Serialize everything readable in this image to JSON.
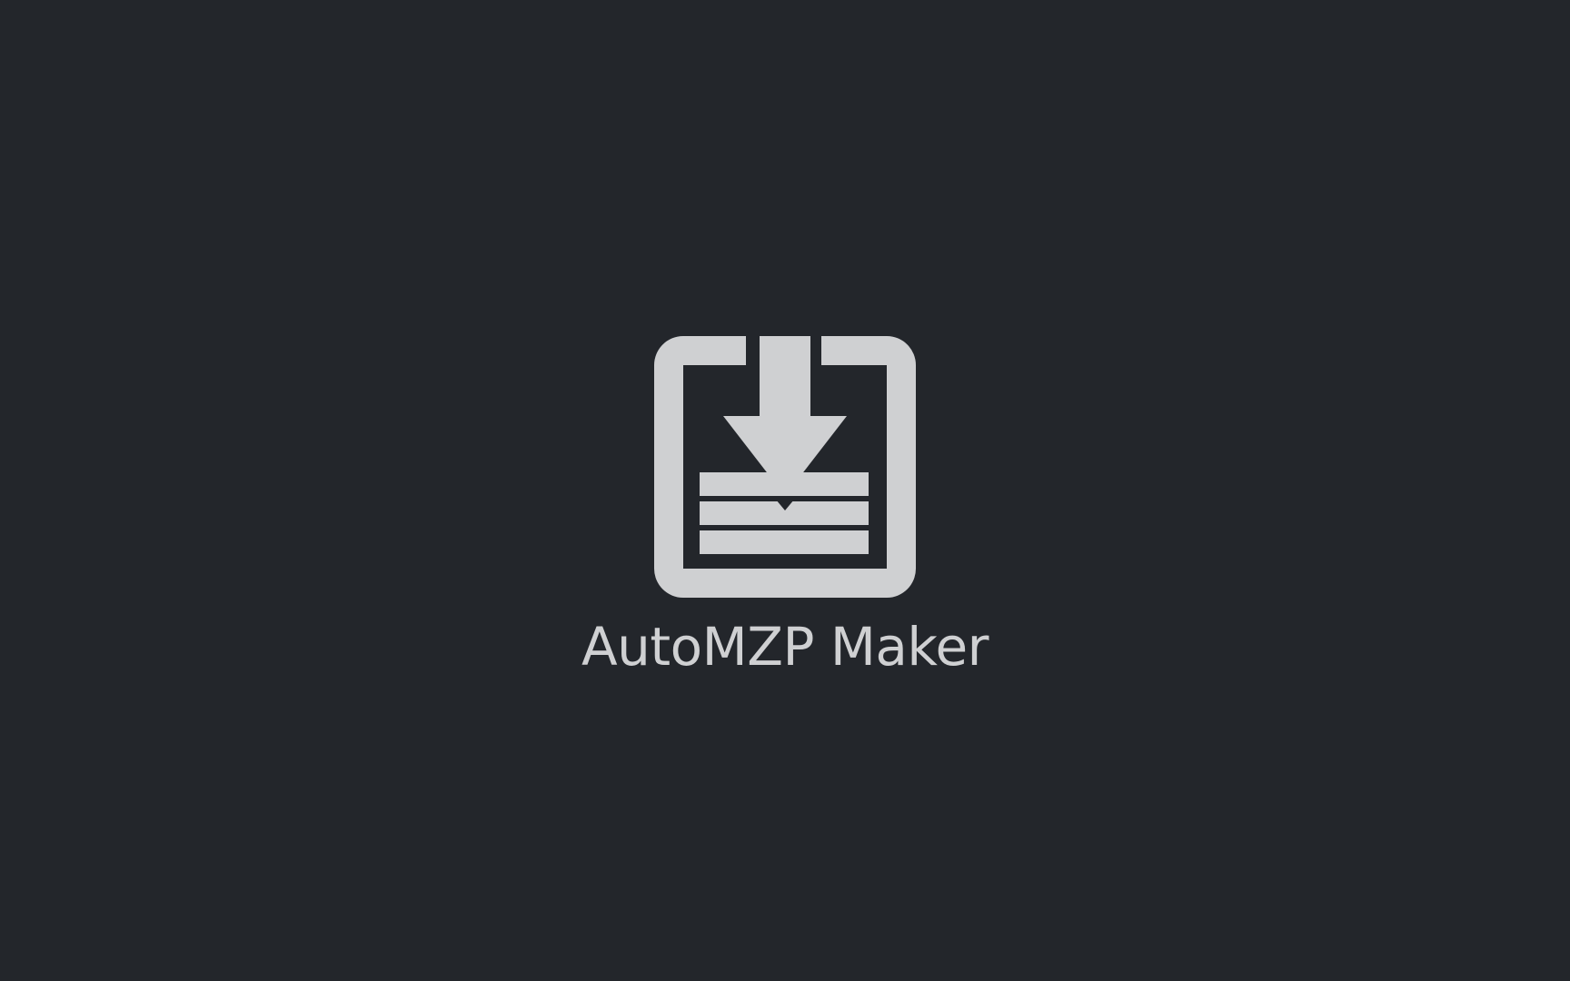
{
  "splash": {
    "app_name": "AutoMZP Maker",
    "logo_icon": "tray-download-icon"
  },
  "colors": {
    "background": "#23262b",
    "foreground": "#cfd0d2"
  }
}
